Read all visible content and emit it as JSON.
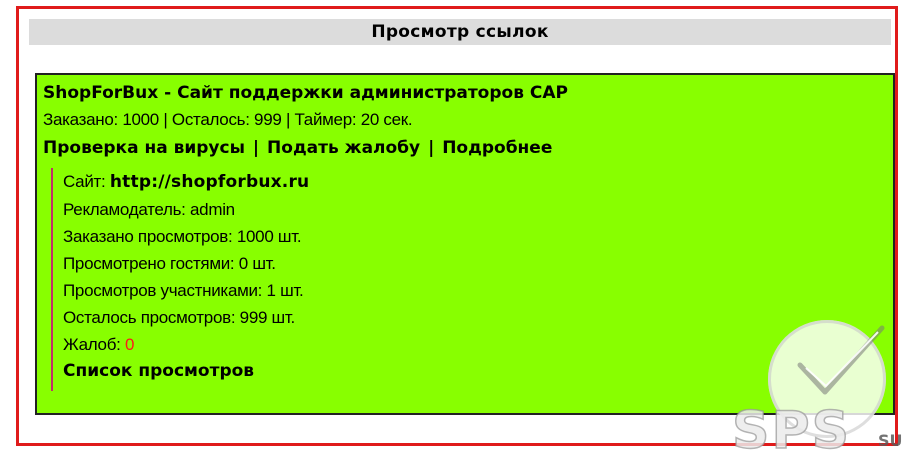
{
  "header": {
    "title": "Просмотр ссылок"
  },
  "card": {
    "title": "ShopForBux - Сайт поддержки администраторов CAP",
    "stats": "Заказано: 1000 | Осталось: 999 | Таймер: 20 сек.",
    "links": {
      "virus_check": "Проверка на вирусы",
      "complaint": "Подать жалобу",
      "details": "Подробнее",
      "separator": "|"
    },
    "details": {
      "site_label": "Сайт:",
      "site_url": "http://shopforbux.ru",
      "advertiser": "Рекламодатель: admin",
      "ordered_views": "Заказано просмотров: 1000 шт.",
      "guest_views": "Просмотрено гостями: 0 шт.",
      "member_views": "Просмотров участниками: 1 шт.",
      "remaining_views": "Осталось просмотров: 999 шт.",
      "complaints_label": "Жалоб:",
      "complaints_count": "0",
      "views_list": "Список просмотров"
    }
  },
  "watermark": {
    "text": "SPS",
    "suffix": "SU"
  },
  "colors": {
    "card_bg": "#88ff00",
    "frame": "#e01b1b",
    "header_bg": "#dcdcdc",
    "accent_line": "#c0306a",
    "complaints_count": "#ff1a1a"
  }
}
